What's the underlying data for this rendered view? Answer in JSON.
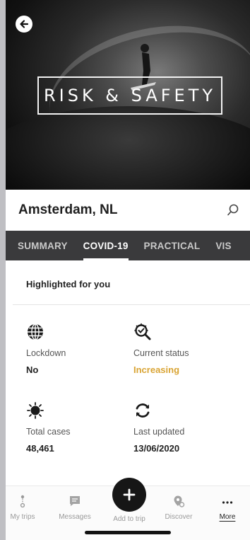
{
  "hero": {
    "title": "RISK & SAFETY"
  },
  "location": {
    "name": "Amsterdam, NL"
  },
  "tabs": [
    {
      "label": "SUMMARY",
      "active": false
    },
    {
      "label": "COVID-19",
      "active": true
    },
    {
      "label": "PRACTICAL",
      "active": false
    },
    {
      "label": "VIS",
      "active": false
    }
  ],
  "highlights": {
    "title": "Highlighted for you",
    "stats": [
      {
        "icon": "globe-icon",
        "label": "Lockdown",
        "value": "No"
      },
      {
        "icon": "virus-search-icon",
        "label": "Current status",
        "value": "Increasing"
      },
      {
        "icon": "virus-icon",
        "label": "Total cases",
        "value": "48,461"
      },
      {
        "icon": "refresh-icon",
        "label": "Last updated",
        "value": "13/06/2020"
      }
    ]
  },
  "colors": {
    "tab_bar": "#3a3a3c",
    "warning": "#d9a434"
  },
  "bottom_nav": {
    "my_trips": "My trips",
    "messages": "Messages",
    "add_to_trip": "Add to trip",
    "discover": "Discover",
    "more": "More"
  }
}
